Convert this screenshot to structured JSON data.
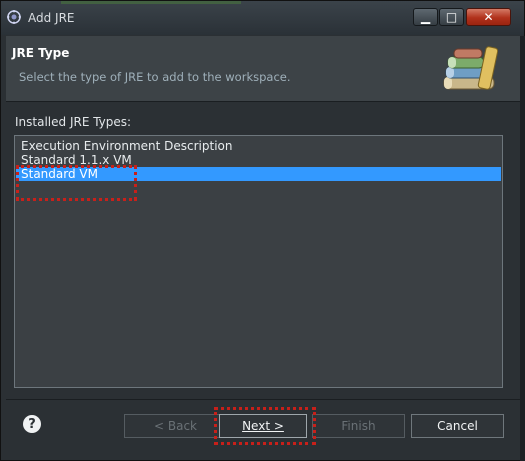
{
  "window": {
    "title": "Add JRE",
    "controls": {
      "minimize": "▁",
      "maximize": "□",
      "close": "✕"
    }
  },
  "header": {
    "title": "JRE Type",
    "description": "Select the type of JRE to add to the workspace.",
    "icon": "jre-library-books-icon"
  },
  "list": {
    "label": "Installed JRE Types:",
    "items": [
      "Execution Environment Description",
      "Standard 1.1.x VM",
      "Standard VM"
    ],
    "selected": "Standard VM"
  },
  "footer": {
    "help": "?",
    "back": "< Back",
    "next": "Next >",
    "finish": "Finish",
    "cancel": "Cancel"
  },
  "colors": {
    "selection": "#3399ff",
    "annotation": "#c8201a",
    "close_button": "#b1311b"
  }
}
